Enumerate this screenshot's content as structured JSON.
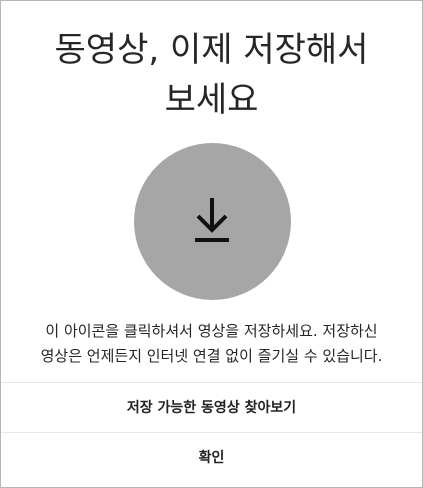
{
  "dialog": {
    "title_line1": "동영상, 이제 저장해서",
    "title_line2": "보세요",
    "icon": "download-icon",
    "circle_color": "#a6a6a6",
    "description_line1": "이 아이콘을 클릭하셔서 영상을 저장하세요. 저장하신",
    "description_line2": "영상은 언제든지 인터넷 연결 없이 즐기실 수 있습니다.",
    "browse_label": "저장 가능한 동영상 찾아보기",
    "confirm_label": "확인"
  }
}
